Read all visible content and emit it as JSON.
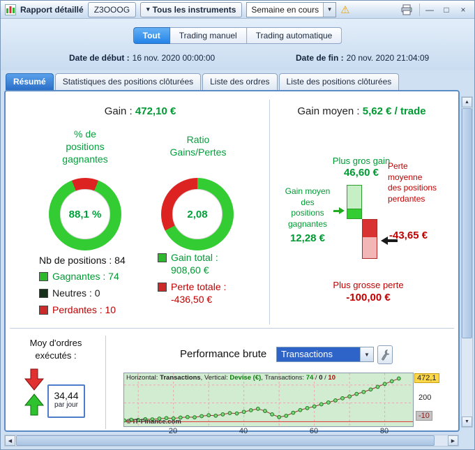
{
  "window": {
    "title": "Rapport détaillé",
    "instrument_button": "Z3OOOG",
    "instruments_button": "Tous les instruments",
    "period_value": "Semaine en cours",
    "controls": {
      "minimize": "—",
      "maximize": "□",
      "close": "×"
    }
  },
  "icons": {
    "dropdown": "▾",
    "combo_arrow": "▼",
    "warning": "⚠",
    "scroll_up": "▲",
    "scroll_down": "▼",
    "scroll_left": "◀",
    "scroll_right": "▶"
  },
  "filters": {
    "modes": [
      {
        "label": "Tout"
      },
      {
        "label": "Trading manuel"
      },
      {
        "label": "Trading automatique"
      }
    ],
    "date_start_label": "Date de début :",
    "date_start_value": "16 nov. 2020 00:00:00",
    "date_end_label": "Date de fin :",
    "date_end_value": "20 nov. 2020 21:04:09"
  },
  "tabs": [
    {
      "label": "Résumé"
    },
    {
      "label": "Statistiques des positions clôturées"
    },
    {
      "label": "Liste des ordres"
    },
    {
      "label": "Liste des positions clôturées"
    }
  ],
  "summary": {
    "gain_label": "Gain :",
    "gain_value": "472,10 €",
    "winrate_title": "% de positions gagnantes",
    "ratio_title": "Ratio Gains/Pertes",
    "winrate_value": "88,1 %",
    "ratio_value": "2,08",
    "nb_positions": "Nb de positions : 84",
    "legend": [
      {
        "label": "Gagnantes : 74",
        "color": "#2eb82e"
      },
      {
        "label": "Neutres : 0",
        "color": "#16301a"
      },
      {
        "label": "Perdantes : 10",
        "color": "#cc2929"
      }
    ],
    "gain_total_label": "Gain total :",
    "gain_total_value": "908,60 €",
    "perte_totale_label": "Perte totale :",
    "perte_totale_value": "-436,50 €"
  },
  "averages": {
    "header_label": "Gain moyen :",
    "header_value": "5,62 € / trade",
    "biggest_gain_label": "Plus gros gain",
    "biggest_gain_value": "46,60 €",
    "avg_win_label": "Gain moyen des positions gagnantes",
    "avg_win_value": "12,28 €",
    "avg_loss_label": "Perte moyenne des positions perdantes",
    "avg_loss_value": "-43,65 €",
    "biggest_loss_label": "Plus grosse perte",
    "biggest_loss_value": "-100,00 €"
  },
  "orders": {
    "title": "Moy d'ordres exécutés :",
    "value": "34,44",
    "unit": "par jour"
  },
  "performance": {
    "title": "Performance brute",
    "combo_value": "Transactions",
    "legend": {
      "h_label": "Horizontal: ",
      "h_value": "Transactions",
      "v_label": ", Vertical: ",
      "v_value": "Devise (€)",
      "t_label": ", Transactions: ",
      "wins": "74",
      "sep1": " / ",
      "neutres": "0",
      "sep2": " / ",
      "pertes": "10"
    },
    "copyright": "© iT-Finance.com",
    "ylabels": [
      "472,1",
      "200",
      "-10"
    ],
    "xlabels": [
      "20",
      "40",
      "60",
      "80"
    ]
  },
  "colors": {
    "green_text": "#009a33",
    "red_text": "#c00000",
    "donut_green": "#33cc33",
    "donut_red": "#dd2222",
    "accent_blue": "#2e64c8"
  },
  "chart_data": [
    {
      "type": "pie",
      "title": "% de positions gagnantes",
      "labels": [
        "Gagnantes",
        "Perdantes"
      ],
      "values": [
        88.1,
        11.9
      ],
      "colors": [
        "#33cc33",
        "#dd2222"
      ],
      "center_label": "88,1 %",
      "red_anchor": "center-top"
    },
    {
      "type": "pie",
      "title": "Ratio Gains/Pertes",
      "labels": [
        "Gain total",
        "Perte totale"
      ],
      "values": [
        908.6,
        436.5
      ],
      "colors": [
        "#33cc33",
        "#dd2222"
      ],
      "center_label": "2,08",
      "red_anchor": "end-top"
    },
    {
      "type": "line",
      "title": "Performance brute",
      "xlabel": "Transactions",
      "ylabel": "Devise (€)",
      "x": [
        6,
        8,
        10,
        12,
        14,
        16,
        18,
        20,
        22,
        24,
        26,
        28,
        30,
        32,
        34,
        36,
        38,
        40,
        42,
        44,
        46,
        48,
        50,
        52,
        54,
        56,
        58,
        60,
        62,
        64,
        66,
        68,
        70,
        72,
        74,
        76,
        78,
        80,
        82,
        84
      ],
      "y": [
        4,
        12,
        10,
        18,
        16,
        24,
        30,
        27,
        36,
        42,
        39,
        52,
        62,
        57,
        72,
        86,
        82,
        100,
        118,
        134,
        110,
        72,
        42,
        56,
        90,
        120,
        142,
        160,
        185,
        205,
        228,
        252,
        272,
        300,
        322,
        350,
        380,
        412,
        442,
        472.1
      ],
      "xticks": [
        20,
        40,
        60,
        80
      ],
      "ytick_labels": [
        "472,1",
        "200",
        "-10"
      ],
      "ytick_values": [
        472.1,
        200,
        -10
      ],
      "xlim": [
        6,
        88
      ],
      "ylim": [
        -30,
        500
      ],
      "final_value": 472.1,
      "grid": true,
      "legend_position": "top-left"
    }
  ]
}
